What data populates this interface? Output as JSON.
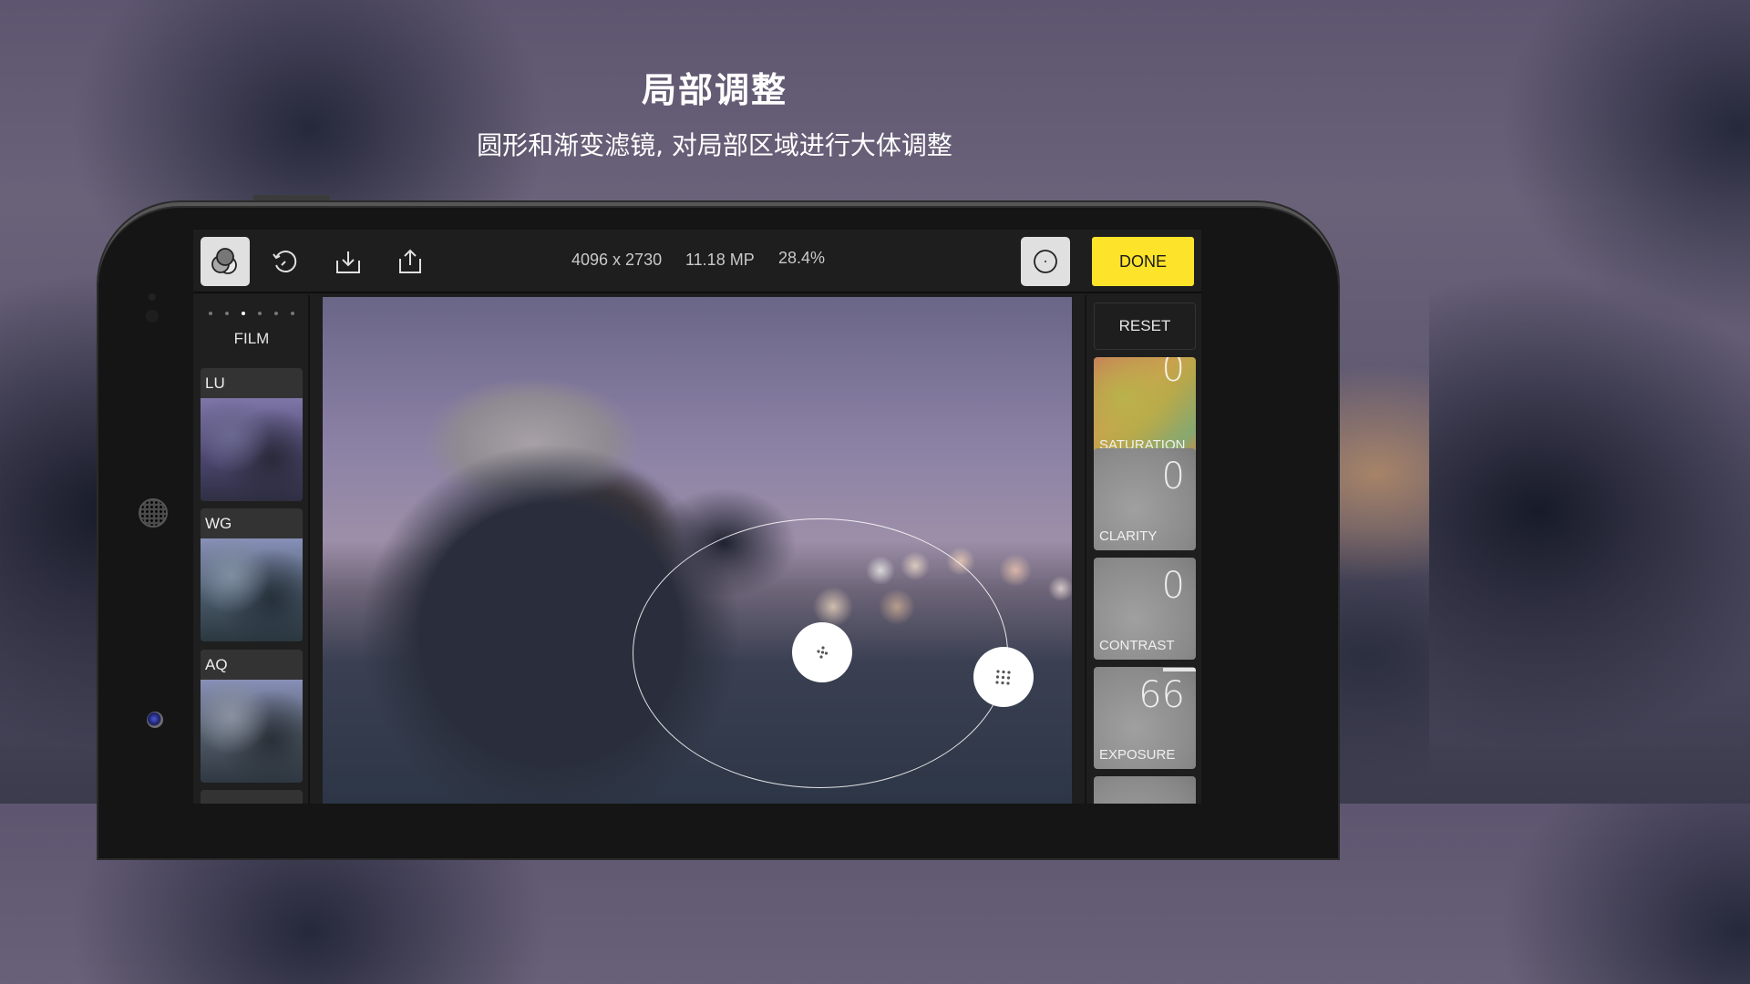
{
  "promo": {
    "title": "局部调整",
    "subtitle": "圆形和渐变滤镜, 对局部区域进行大体调整"
  },
  "toolbar": {
    "filters_icon": "overlapping-circles-icon",
    "history_icon": "history-icon",
    "save_icon": "download-icon",
    "share_icon": "share-icon",
    "dimensions": "4096 x 2730",
    "megapixels": "11.18 MP",
    "zoom": "28.4%",
    "radial_icon": "radial-filter-icon",
    "done_label": "DONE",
    "done_color": "#fde32a"
  },
  "left_panel": {
    "page_dots": {
      "count": 6,
      "active_index": 2
    },
    "category": "FILM",
    "presets": [
      {
        "label": "LU"
      },
      {
        "label": "WG"
      },
      {
        "label": "AQ"
      }
    ]
  },
  "photo": {
    "filter_shape": "ellipse",
    "handles": [
      "move-handle",
      "resize-handle"
    ]
  },
  "right_panel": {
    "reset_label": "RESET",
    "adjustments": [
      {
        "label": "SATURATION",
        "value": "0"
      },
      {
        "label": "CLARITY",
        "value": "0"
      },
      {
        "label": "CONTRAST",
        "value": "0"
      },
      {
        "label": "EXPOSURE",
        "value": "66"
      }
    ]
  }
}
